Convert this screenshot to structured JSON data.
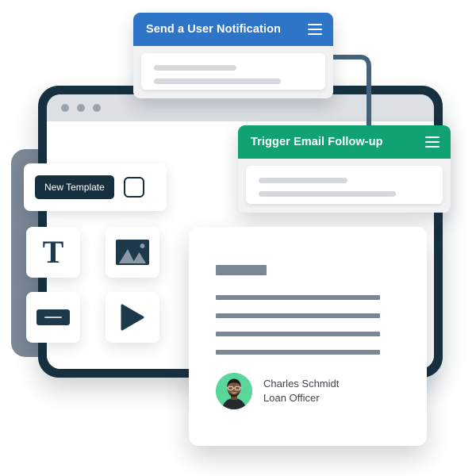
{
  "browser": {
    "name": "browser-window",
    "traffic_lights": [
      "dot-1",
      "dot-2",
      "dot-3"
    ]
  },
  "notification_card": {
    "title": "Send a User Notification",
    "accent_color": "#2e75c7",
    "menu_icon": "hamburger-icon",
    "placeholder_lines": [
      "line-short",
      "line-long"
    ]
  },
  "followup_card": {
    "title": "Trigger Email Follow-up",
    "accent_color": "#10a272",
    "menu_icon": "hamburger-icon",
    "placeholder_lines": [
      "line-short",
      "line-long"
    ]
  },
  "toolbar": {
    "new_template_label": "New Template",
    "button_color": "#16303f",
    "checkbox_checked": false
  },
  "tools": [
    {
      "name": "text-tool",
      "icon": "text-T-icon",
      "glyph": "T"
    },
    {
      "name": "image-tool",
      "icon": "image-icon",
      "glyph": ""
    },
    {
      "name": "button-tool",
      "icon": "button-icon",
      "glyph": ""
    },
    {
      "name": "video-tool",
      "icon": "play-icon",
      "glyph": ""
    }
  ],
  "document": {
    "heading_block": "heading-placeholder",
    "body_lines": [
      "line-1",
      "line-2",
      "line-3",
      "line-4"
    ],
    "line_color": "#7b8794",
    "author": {
      "name": "Charles Schmidt",
      "role": "Loan Officer",
      "avatar_bg": "#5bd69b"
    }
  },
  "connector": {
    "name": "flow-connector",
    "color": "#45627a"
  }
}
